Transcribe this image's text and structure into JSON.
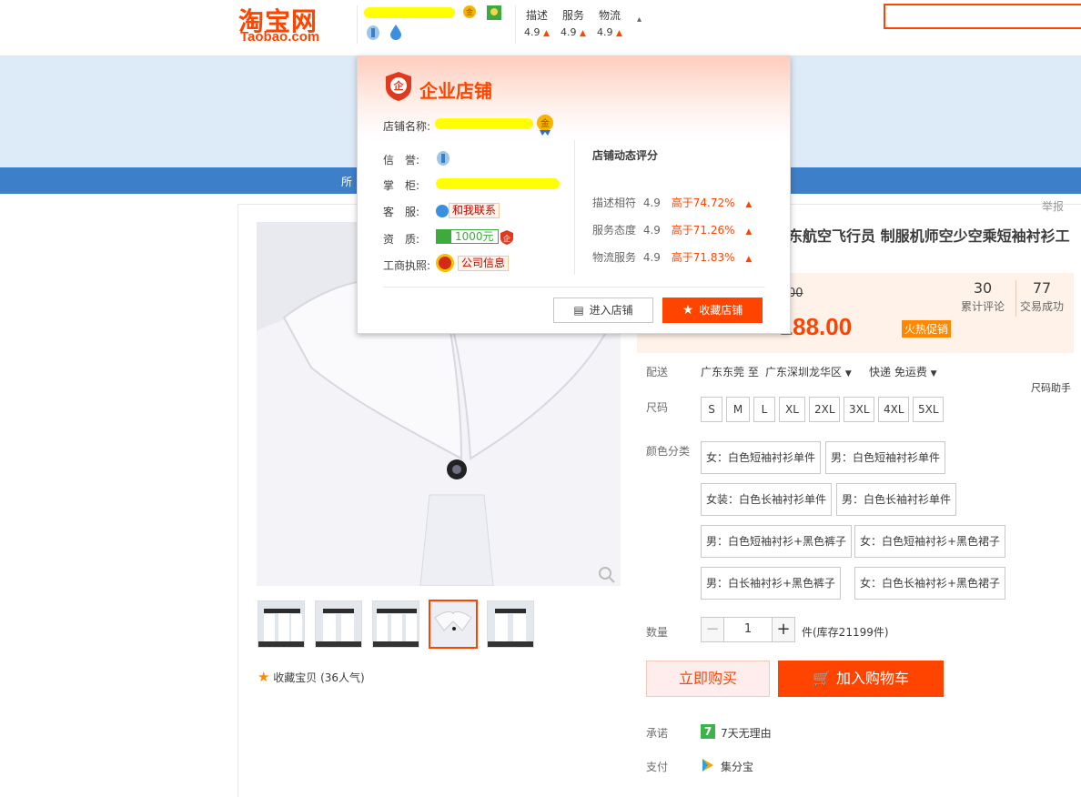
{
  "header": {
    "logo_cn": "淘宝网",
    "logo_en": "Taobao.com",
    "scores": [
      {
        "label": "描述",
        "value": "4.9"
      },
      {
        "label": "服务",
        "value": "4.9"
      },
      {
        "label": "物流",
        "value": "4.9"
      }
    ],
    "expand_arrow": "▴"
  },
  "nav": {
    "first_item": "所"
  },
  "popup": {
    "title": "企业店铺",
    "shop_name_label": "店铺名称:",
    "credit_label": "信　誉:",
    "owner_label": "掌　柜:",
    "service_label": "客　服:",
    "service_link": "和我联系",
    "qualification_label": "资　质:",
    "deposit": "1000元",
    "license_label": "工商执照:",
    "license_link": "公司信息",
    "dynamic_title": "店铺动态评分",
    "dynamic": [
      {
        "label": "描述相符",
        "value": "4.9",
        "compare": "高于74.72%"
      },
      {
        "label": "服务态度",
        "value": "4.9",
        "compare": "高于71.26%"
      },
      {
        "label": "物流服务",
        "value": "4.9",
        "compare": "高于71.83%"
      }
    ],
    "enter_shop": "进入店铺",
    "favorite_shop": "收藏店铺"
  },
  "product": {
    "report": "举报",
    "title": "东航空飞行员 制服机师空少空乘短袖衬衫工",
    "old_price_tail": "00",
    "price": "-188.00",
    "price_tag": "火热促销",
    "reviews_count": "30",
    "reviews_label": "累计评论",
    "deals_count": "77",
    "deals_label": "交易成功",
    "delivery_label": "配送",
    "delivery_from": "广东东莞 至",
    "delivery_to": "广东深圳龙华区",
    "delivery_method": "快递 免运费",
    "size_helper": "尺码助手",
    "size_label": "尺码",
    "sizes": [
      "S",
      "M",
      "L",
      "XL",
      "2XL",
      "3XL",
      "4XL",
      "5XL"
    ],
    "color_label": "颜色分类",
    "colors": [
      "女：白色短袖衬衫单件",
      "男：白色短袖衬衫单件",
      "女装：白色长袖衬衫单件",
      "男：白色长袖衬衫单件",
      "男：白色短袖衬衫+黑色裤子",
      "女：白色短袖衬衫+黑色裙子",
      "男：白长袖衬衫+黑色裤子",
      "女：白色长袖衬衫+黑色裙子"
    ],
    "qty_label": "数量",
    "qty_minus": "−",
    "qty_value": "1",
    "qty_plus": "+",
    "stock": "件(库存21199件)",
    "buy_now": "立即购买",
    "add_cart": "加入购物车",
    "promise_label": "承诺",
    "promise_icon": "7",
    "promise_text": "7天无理由",
    "pay_label": "支付",
    "pay_text": "集分宝",
    "favorite_item": "收藏宝贝 (36人气)"
  }
}
